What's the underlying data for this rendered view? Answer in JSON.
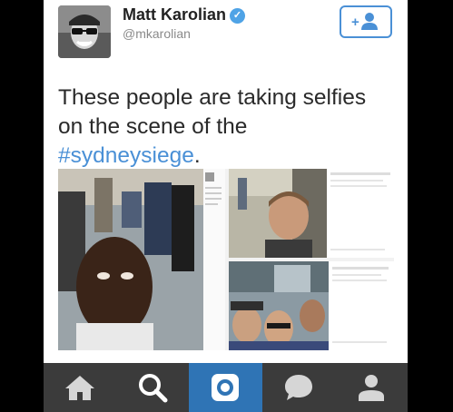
{
  "tweet": {
    "author_name": "Matt Karolian",
    "author_handle": "@mkarolian",
    "verified": true,
    "text_before": "These people are taking selfies on the scene of the ",
    "hashtag": "#sydneysiege",
    "text_after": "."
  },
  "follow_button": {
    "icon": "add-user-icon"
  },
  "tabbar": {
    "tabs": [
      {
        "icon": "home-icon"
      },
      {
        "icon": "search-icon"
      },
      {
        "icon": "camera-icon",
        "active": true
      },
      {
        "icon": "chat-bubble-icon"
      },
      {
        "icon": "profile-icon"
      }
    ]
  },
  "colors": {
    "accent": "#4a90d6",
    "active_tab": "#2f74b5",
    "tabbar_bg": "#3b3b3b",
    "text": "#2a2a2a"
  }
}
